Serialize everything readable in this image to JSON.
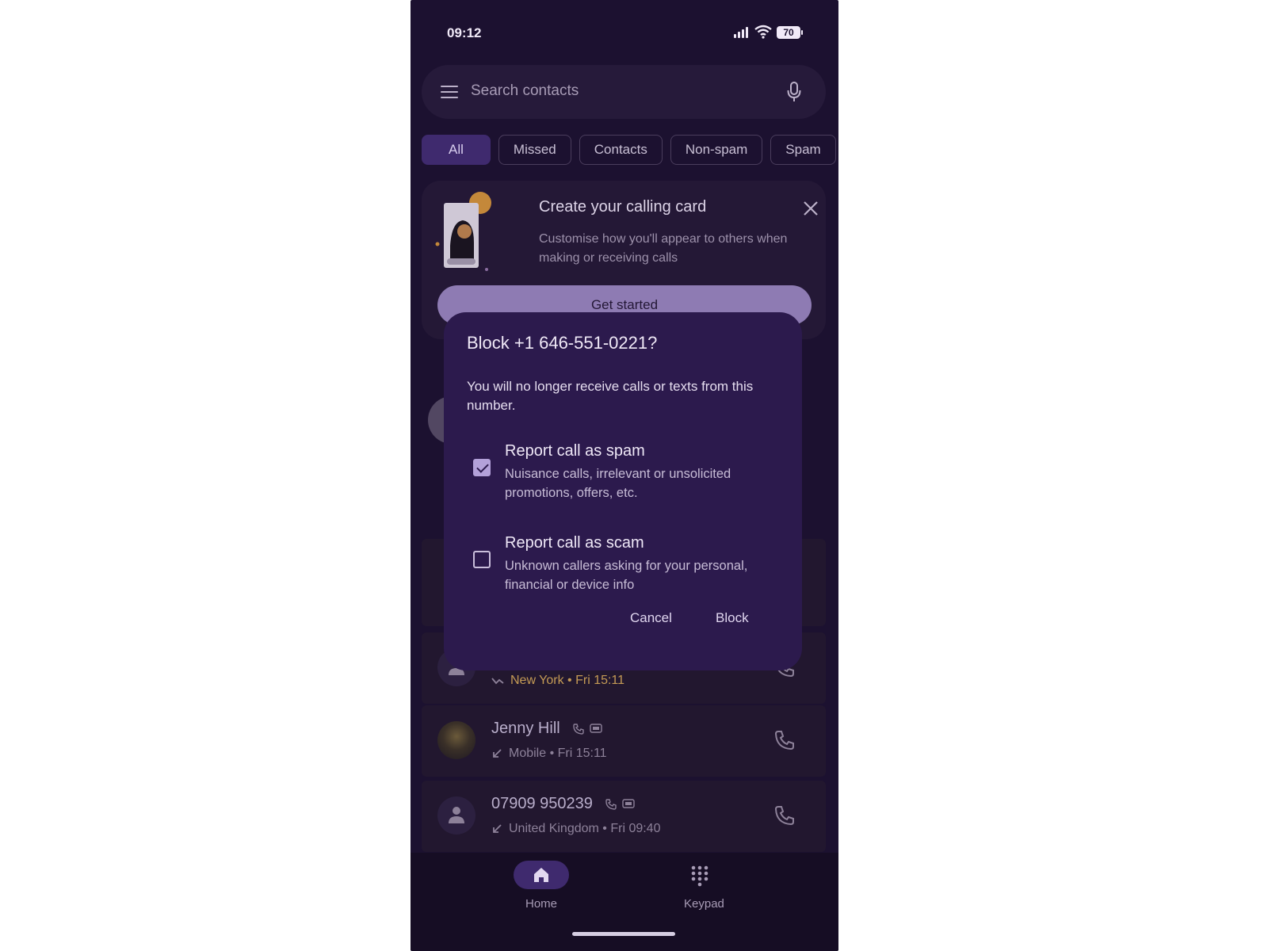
{
  "status_bar": {
    "time": "09:12",
    "battery": "70"
  },
  "search": {
    "placeholder": "Search contacts"
  },
  "chips": [
    "All",
    "Missed",
    "Contacts",
    "Non-spam",
    "Spam"
  ],
  "calling_card": {
    "title": "Create your calling card",
    "description": "Customise how you'll appear to others when making or receiving calls",
    "button": "Get started"
  },
  "calls": [
    {
      "name": "",
      "detail": "New York • Fri 15:11"
    },
    {
      "name": "Jenny Hill",
      "detail": "Mobile • Fri 15:11"
    },
    {
      "name": "07909 950239",
      "detail": "United Kingdom • Fri 09:40"
    }
  ],
  "bottom_nav": {
    "home": "Home",
    "keypad": "Keypad"
  },
  "dialog": {
    "title": "Block +1 646-551-0221?",
    "body": "You will no longer receive calls or texts from this number.",
    "options": [
      {
        "title": "Report call as spam",
        "description": "Nuisance calls, irrelevant or unsolicited promotions, offers, etc.",
        "checked": true
      },
      {
        "title": "Report call as scam",
        "description": "Unknown callers asking for your personal, financial or device info",
        "checked": false
      }
    ],
    "cancel": "Cancel",
    "block": "Block"
  },
  "colors": {
    "background": "#1c1130",
    "accent": "#3f2a6e",
    "dialog": "#2c1a4d",
    "warning": "#c49a55"
  }
}
